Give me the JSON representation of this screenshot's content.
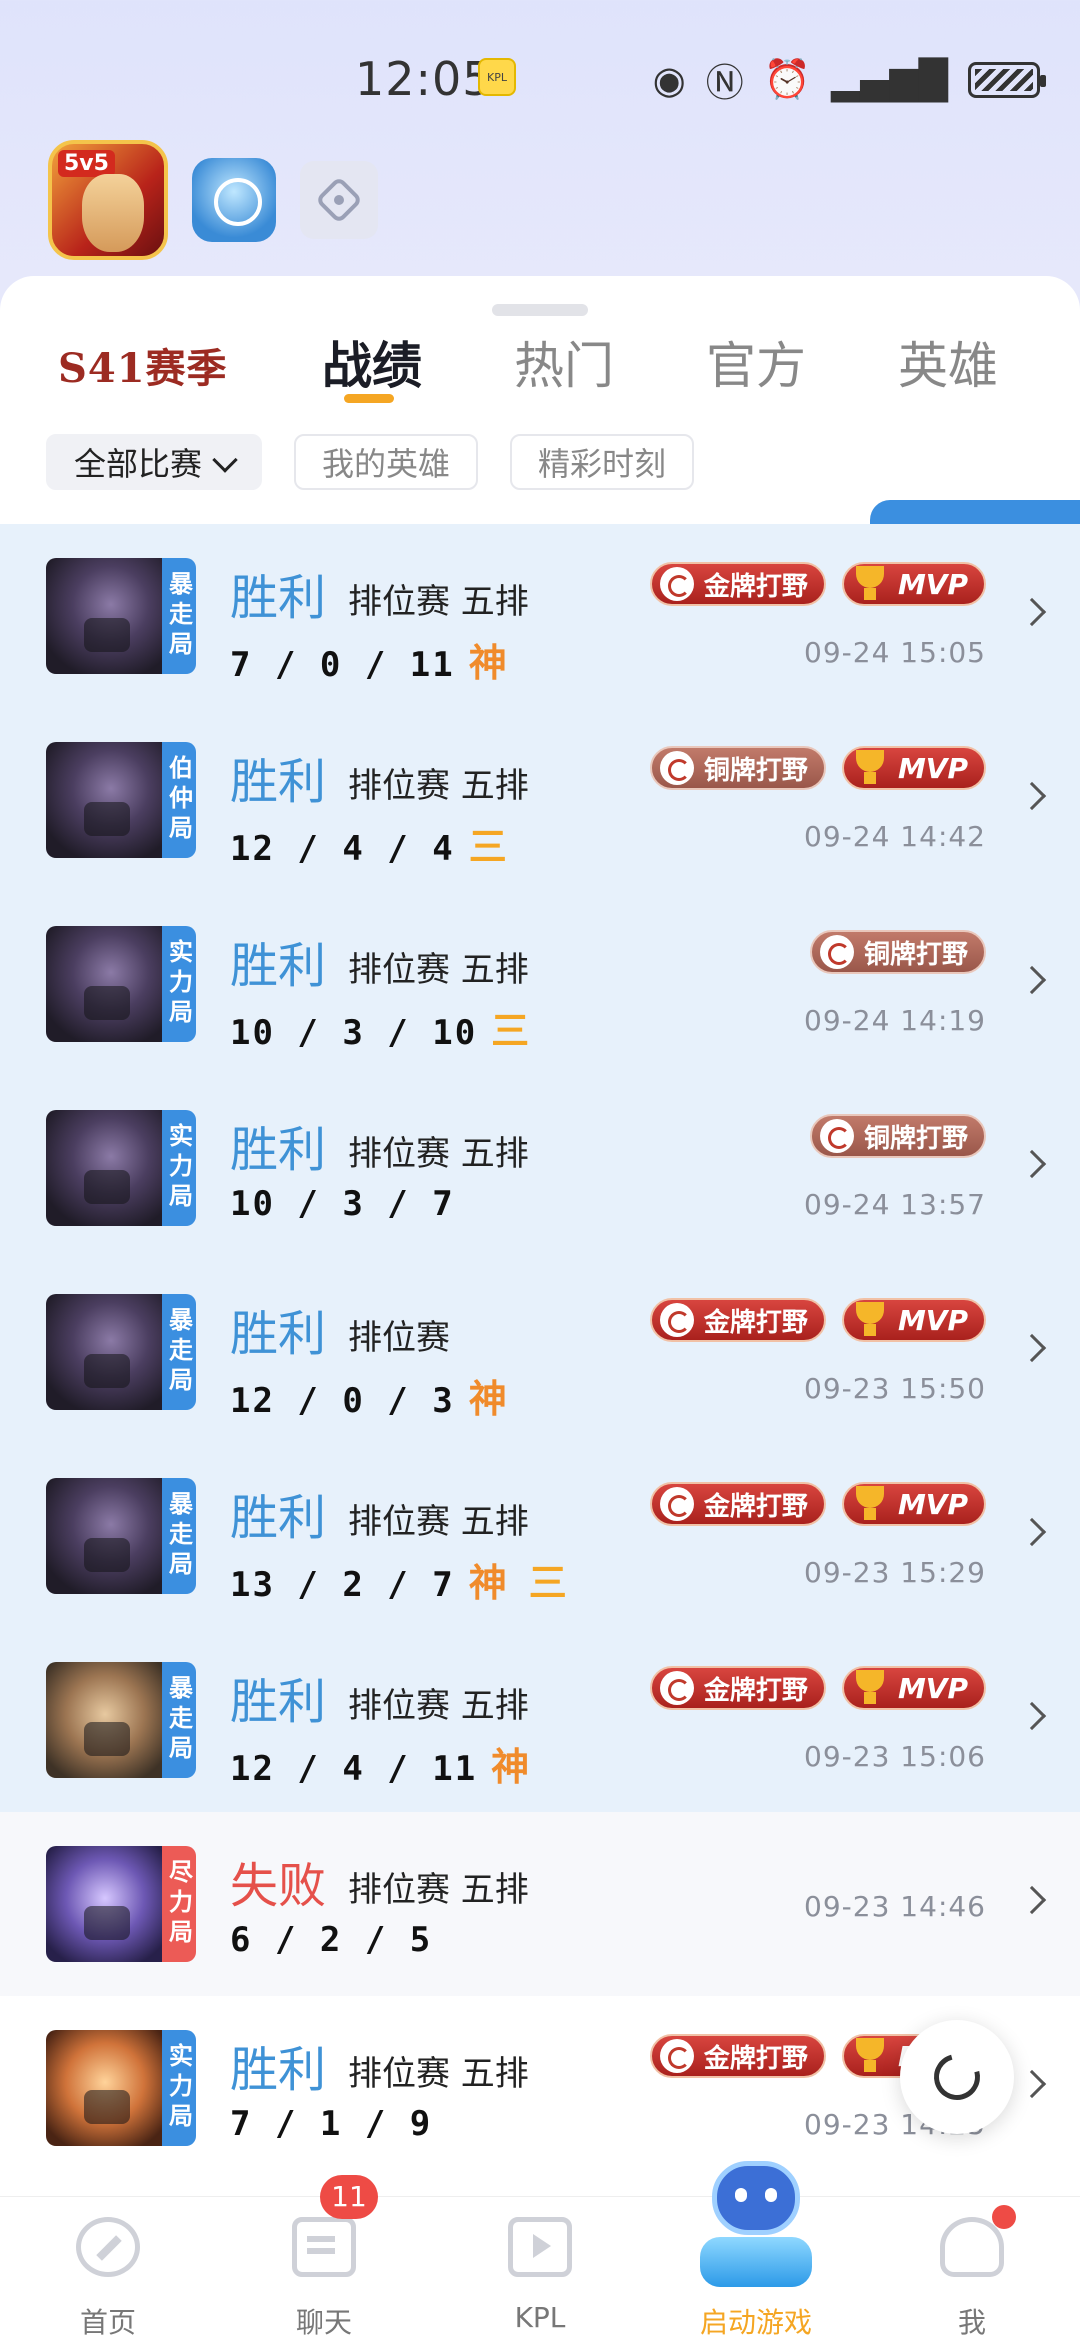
{
  "status": {
    "time": "12:05",
    "app_tag": "KPL"
  },
  "season": "S41赛季",
  "tabs": [
    "战绩",
    "热门",
    "官方",
    "英雄"
  ],
  "filters": {
    "all": "全部比赛",
    "my_heroes": "我的英雄",
    "highlights": "精彩时刻"
  },
  "matches": [
    {
      "level": "暴走局",
      "result": "胜利",
      "mode": "排位赛 五排",
      "kda": "7 / 0 / 11",
      "marks": [
        "神"
      ],
      "badges": [
        "金牌打野",
        "MVP"
      ],
      "time": "09-24 15:05"
    },
    {
      "level": "伯仲局",
      "result": "胜利",
      "mode": "排位赛 五排",
      "kda": "12 / 4 / 4",
      "marks": [
        "三"
      ],
      "badges": [
        "铜牌打野",
        "MVP"
      ],
      "time": "09-24 14:42"
    },
    {
      "level": "实力局",
      "result": "胜利",
      "mode": "排位赛 五排",
      "kda": "10 / 3 / 10",
      "marks": [
        "三"
      ],
      "badges": [
        "铜牌打野"
      ],
      "time": "09-24 14:19"
    },
    {
      "level": "实力局",
      "result": "胜利",
      "mode": "排位赛 五排",
      "kda": "10 / 3 / 7",
      "marks": [],
      "badges": [
        "铜牌打野"
      ],
      "time": "09-24 13:57"
    },
    {
      "level": "暴走局",
      "result": "胜利",
      "mode": "排位赛",
      "kda": "12 / 0 / 3",
      "marks": [
        "神"
      ],
      "badges": [
        "金牌打野",
        "MVP"
      ],
      "time": "09-23 15:50"
    },
    {
      "level": "暴走局",
      "result": "胜利",
      "mode": "排位赛 五排",
      "kda": "13 / 2 / 7",
      "marks": [
        "神",
        "三"
      ],
      "badges": [
        "金牌打野",
        "MVP"
      ],
      "time": "09-23 15:29"
    },
    {
      "level": "暴走局",
      "result": "胜利",
      "mode": "排位赛 五排",
      "kda": "12 / 4 / 11",
      "marks": [
        "神"
      ],
      "badges": [
        "金牌打野",
        "MVP"
      ],
      "time": "09-23 15:06"
    },
    {
      "level": "尽力局",
      "result": "失败",
      "mode": "排位赛 五排",
      "kda": "6 / 2 / 5",
      "marks": [],
      "badges": [],
      "time": "09-23 14:46"
    },
    {
      "level": "实力局",
      "result": "胜利",
      "mode": "排位赛 五排",
      "kda": "7 / 1 / 9",
      "marks": [],
      "badges": [
        "金牌打野",
        "MVP"
      ],
      "time": "09-23 14:25"
    }
  ],
  "nav": {
    "home": "首页",
    "chat": "聊天",
    "chat_badge": "11",
    "kpl": "KPL",
    "launch": "启动游戏",
    "me": "我"
  },
  "colors": {
    "win": "#3f92d6",
    "lose": "#e5504a",
    "accent": "#f5a623",
    "win_bg": "#e7f1fb"
  }
}
